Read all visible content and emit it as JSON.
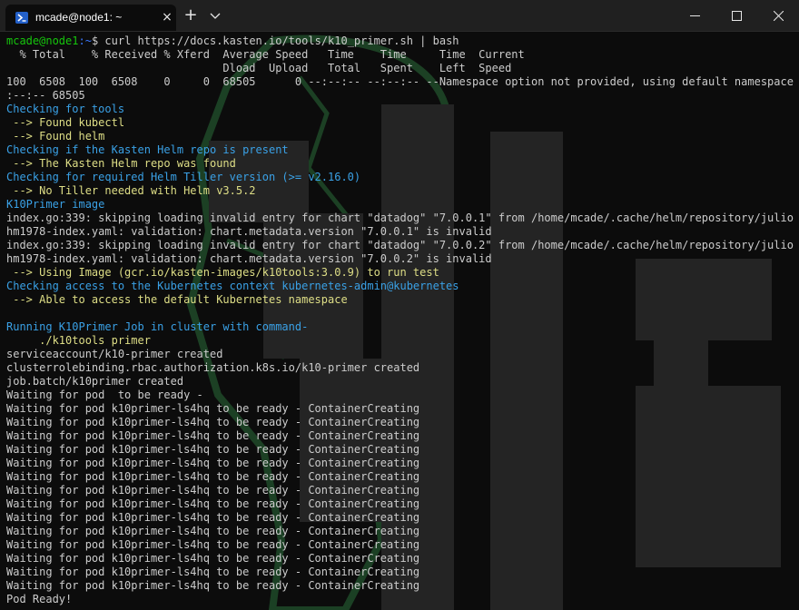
{
  "window": {
    "tab_title": "mcade@node1: ~",
    "new_tab_label": "+",
    "tab_close_label": "×"
  },
  "terminal": {
    "prompt_user": "mcade@node1",
    "prompt_path": ":~",
    "prompt_symbol": "$ ",
    "command": "curl https://docs.kasten.io/tools/k10_primer.sh | bash",
    "lines": [
      {
        "text": "  % Total    % Received % Xferd  Average Speed   Time    Time     Time  Current",
        "color": "default"
      },
      {
        "text": "                                 Dload  Upload   Total   Spent    Left  Speed",
        "color": "default"
      },
      {
        "text": "100  6508  100  6508    0     0  68505      0 --:--:-- --:--:-- --Namespace option not provided, using default namespace",
        "color": "default"
      },
      {
        "text": ":--:-- 68505",
        "color": "default"
      },
      {
        "text": "Checking for tools",
        "color": "blue"
      },
      {
        "text": " --> Found kubectl",
        "color": "yellow"
      },
      {
        "text": " --> Found helm",
        "color": "yellow"
      },
      {
        "text": "Checking if the Kasten Helm repo is present",
        "color": "blue"
      },
      {
        "text": " --> The Kasten Helm repo was found",
        "color": "yellow"
      },
      {
        "text": "Checking for required Helm Tiller version (>= v2.16.0)",
        "color": "blue"
      },
      {
        "text": " --> No Tiller needed with Helm v3.5.2",
        "color": "yellow"
      },
      {
        "text": "K10Primer image",
        "color": "blue"
      },
      {
        "text": "index.go:339: skipping loading invalid entry for chart \"datadog\" \"7.0.0.1\" from /home/mcade/.cache/helm/repository/julio",
        "color": "default"
      },
      {
        "text": "hm1978-index.yaml: validation: chart.metadata.version \"7.0.0.1\" is invalid",
        "color": "default"
      },
      {
        "text": "index.go:339: skipping loading invalid entry for chart \"datadog\" \"7.0.0.2\" from /home/mcade/.cache/helm/repository/julio",
        "color": "default"
      },
      {
        "text": "hm1978-index.yaml: validation: chart.metadata.version \"7.0.0.2\" is invalid",
        "color": "default"
      },
      {
        "text": " --> Using Image (gcr.io/kasten-images/k10tools:3.0.9) to run test",
        "color": "yellow"
      },
      {
        "text": "Checking access to the Kubernetes context kubernetes-admin@kubernetes",
        "color": "blue"
      },
      {
        "text": " --> Able to access the default Kubernetes namespace",
        "color": "yellow"
      },
      {
        "text": "",
        "color": "default"
      },
      {
        "text": "Running K10Primer Job in cluster with command-",
        "color": "blue"
      },
      {
        "text": "     ./k10tools primer",
        "color": "yellow"
      },
      {
        "text": "serviceaccount/k10-primer created",
        "color": "default"
      },
      {
        "text": "clusterrolebinding.rbac.authorization.k8s.io/k10-primer created",
        "color": "default"
      },
      {
        "text": "job.batch/k10primer created",
        "color": "default"
      },
      {
        "text": "Waiting for pod  to be ready -",
        "color": "default"
      },
      {
        "text": "Waiting for pod k10primer-ls4hq to be ready - ContainerCreating",
        "color": "default"
      },
      {
        "text": "Waiting for pod k10primer-ls4hq to be ready - ContainerCreating",
        "color": "default"
      },
      {
        "text": "Waiting for pod k10primer-ls4hq to be ready - ContainerCreating",
        "color": "default"
      },
      {
        "text": "Waiting for pod k10primer-ls4hq to be ready - ContainerCreating",
        "color": "default"
      },
      {
        "text": "Waiting for pod k10primer-ls4hq to be ready - ContainerCreating",
        "color": "default"
      },
      {
        "text": "Waiting for pod k10primer-ls4hq to be ready - ContainerCreating",
        "color": "default"
      },
      {
        "text": "Waiting for pod k10primer-ls4hq to be ready - ContainerCreating",
        "color": "default"
      },
      {
        "text": "Waiting for pod k10primer-ls4hq to be ready - ContainerCreating",
        "color": "default"
      },
      {
        "text": "Waiting for pod k10primer-ls4hq to be ready - ContainerCreating",
        "color": "default"
      },
      {
        "text": "Waiting for pod k10primer-ls4hq to be ready - ContainerCreating",
        "color": "default"
      },
      {
        "text": "Waiting for pod k10primer-ls4hq to be ready - ContainerCreating",
        "color": "default"
      },
      {
        "text": "Waiting for pod k10primer-ls4hq to be ready - ContainerCreating",
        "color": "default"
      },
      {
        "text": "Waiting for pod k10primer-ls4hq to be ready - ContainerCreating",
        "color": "default"
      },
      {
        "text": "Waiting for pod k10primer-ls4hq to be ready - ContainerCreating",
        "color": "default"
      },
      {
        "text": "Pod Ready!",
        "color": "default"
      }
    ]
  },
  "colors": {
    "default": "#cccccc",
    "blue": "#3aa1e6",
    "yellow": "#dede86",
    "prompt": "#16c60c",
    "path": "#3b78ff",
    "background": "#0c0c0c",
    "titlebar": "#202020"
  },
  "icons": {
    "tab_icon": "powershell-terminal-icon",
    "dropdown": "chevron-down-icon",
    "minimize": "minimize-icon",
    "maximize": "maximize-icon",
    "close": "close-icon"
  }
}
